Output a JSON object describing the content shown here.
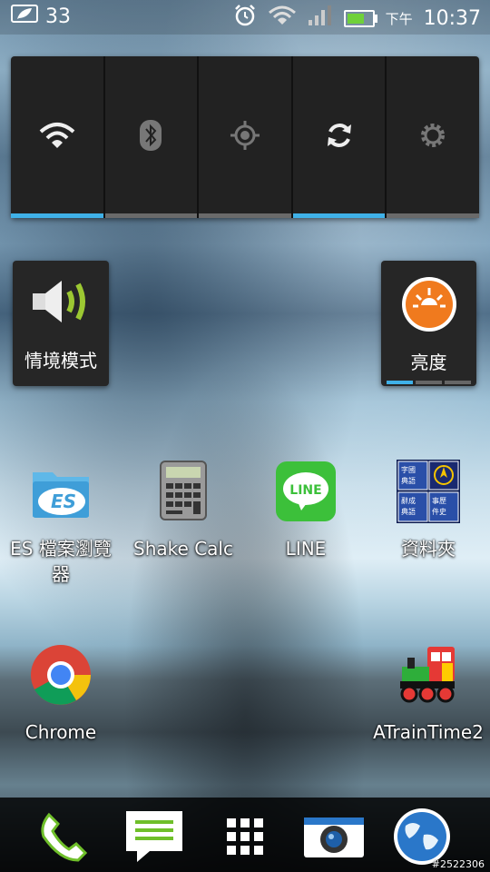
{
  "status_bar": {
    "notification_count": "33",
    "ampm": "下午",
    "time": "10:37",
    "icons": [
      "leaf-notification-icon",
      "alarm-icon",
      "wifi-icon",
      "signal-icon",
      "battery-icon"
    ],
    "battery_level": 0.7
  },
  "quick_settings": [
    {
      "name": "wifi-icon",
      "active": true
    },
    {
      "name": "bluetooth-icon",
      "active": false
    },
    {
      "name": "gps-icon",
      "active": false
    },
    {
      "name": "sync-icon",
      "active": true
    },
    {
      "name": "settings-icon",
      "active": false
    }
  ],
  "widgets": {
    "sound_profile": {
      "label": "情境模式"
    },
    "brightness": {
      "label": "亮度",
      "level_segments": 1,
      "total_segments": 3
    }
  },
  "apps": [
    {
      "label": "ES 檔案瀏覽器",
      "icon": "es-file-explorer-icon"
    },
    {
      "label": "Shake Calc",
      "icon": "calculator-icon"
    },
    {
      "label": "LINE",
      "icon": "line-icon"
    },
    {
      "label": "資料夾",
      "icon": "folder-icon",
      "folder_items": [
        "字國",
        "典語",
        "辭成",
        "典語",
        "事歷",
        "件史"
      ]
    },
    {
      "label": "Chrome",
      "icon": "chrome-icon"
    },
    {
      "label": "ATrainTime2",
      "icon": "train-icon"
    }
  ],
  "line_logo_text": "LINE",
  "es_logo_text": "ES",
  "dock": [
    "phone-icon",
    "messages-icon",
    "app-drawer-icon",
    "camera-icon",
    "browser-globe-icon"
  ],
  "watermark": "#2522306",
  "colors": {
    "accent": "#3fb1e8",
    "brightness_orange": "#f07a1e",
    "line_green": "#3cc03a"
  }
}
